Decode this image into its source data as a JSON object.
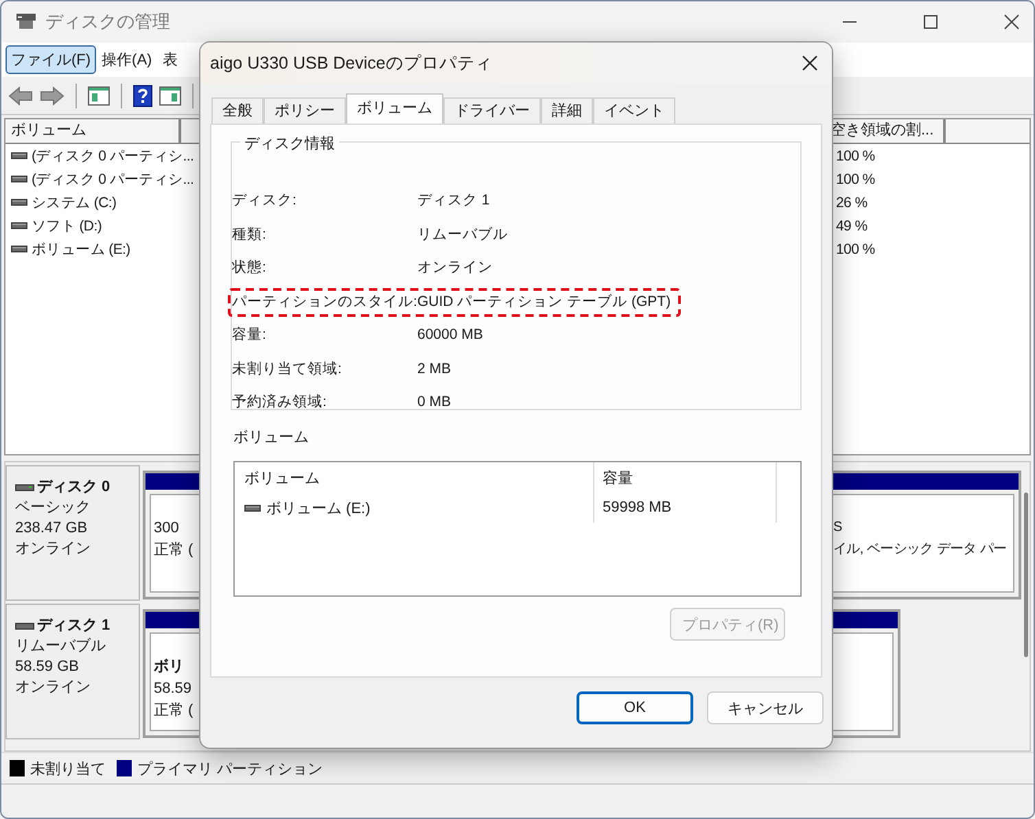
{
  "window": {
    "title": "ディスクの管理"
  },
  "menu": [
    {
      "label": "ファイル(F)",
      "selected": true
    },
    {
      "label": "操作(A)",
      "selected": false
    },
    {
      "label": "表",
      "selected": false
    }
  ],
  "volume_list": {
    "columns": [
      "ボリューム",
      "空き領域の割..."
    ],
    "rows": [
      {
        "volume": "(ディスク 0 パーティシ...",
        "free": "100 %"
      },
      {
        "volume": "(ディスク 0 パーティシ...",
        "free": "100 %"
      },
      {
        "volume": "システム (C:)",
        "free": "26 %"
      },
      {
        "volume": "ソフト (D:)",
        "free": "49 %"
      },
      {
        "volume": "ボリューム (E:)",
        "free": "100 %"
      }
    ]
  },
  "disks": [
    {
      "name": "ディスク 0",
      "type": "ベーシック",
      "size": "238.47 GB",
      "status": "オンライン",
      "partitions": [
        {
          "lines": [
            "300",
            "正常 ("
          ]
        },
        {
          "lines": [
            "S",
            "イル, ベーシック データ パー"
          ]
        }
      ]
    },
    {
      "name": "ディスク 1",
      "type": "リムーバブル",
      "size": "58.59 GB",
      "status": "オンライン",
      "partitions": [
        {
          "lines": [
            "ボリ",
            "58.59",
            "正常 ("
          ]
        }
      ]
    }
  ],
  "legend": [
    {
      "label": "未割り当て",
      "color": "#000000"
    },
    {
      "label": "プライマリ パーティション",
      "color": "#000080"
    }
  ],
  "dialog": {
    "title": "aigo U330 USB Deviceのプロパティ",
    "tabs": [
      {
        "label": "全般",
        "selected": false
      },
      {
        "label": "ポリシー",
        "selected": false
      },
      {
        "label": "ボリューム",
        "selected": true
      },
      {
        "label": "ドライバー",
        "selected": false
      },
      {
        "label": "詳細",
        "selected": false
      },
      {
        "label": "イベント",
        "selected": false
      }
    ],
    "disk_info": {
      "title": "ディスク情報",
      "rows": [
        {
          "label": "ディスク:",
          "value": "ディスク 1",
          "highlighted": false
        },
        {
          "label": "種類:",
          "value": "リムーバブル",
          "highlighted": false
        },
        {
          "label": "状態:",
          "value": "オンライン",
          "highlighted": false
        },
        {
          "label": "パーティションのスタイル:",
          "value": "GUID パーティション テーブル (GPT)",
          "highlighted": true
        },
        {
          "label": "容量:",
          "value": "60000 MB",
          "highlighted": false
        },
        {
          "label": "未割り当て領域:",
          "value": "2 MB",
          "highlighted": false
        },
        {
          "label": "予約済み領域:",
          "value": "0 MB",
          "highlighted": false
        }
      ]
    },
    "volumes": {
      "title": "ボリューム",
      "columns": [
        "ボリューム",
        "容量"
      ],
      "rows": [
        {
          "volume": "ボリューム (E:)",
          "capacity": "59998 MB"
        }
      ]
    },
    "properties_button": {
      "label": "プロパティ(R)",
      "disabled": true
    },
    "buttons": [
      {
        "label": "OK",
        "default": true
      },
      {
        "label": "キャンセル",
        "default": false
      }
    ]
  }
}
